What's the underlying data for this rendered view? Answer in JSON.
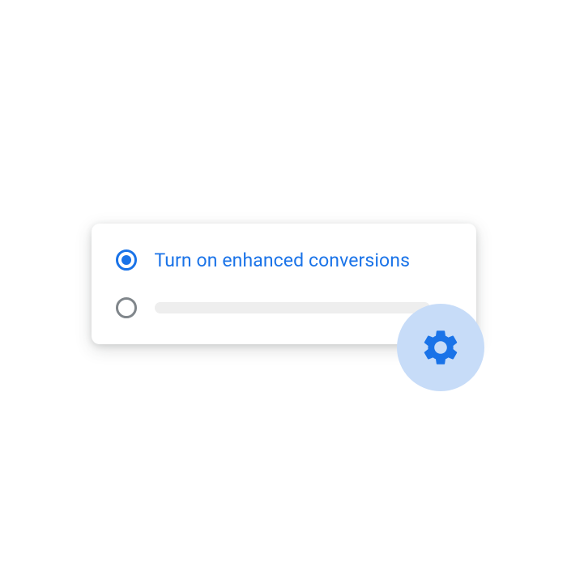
{
  "card": {
    "options": [
      {
        "label": "Turn on enhanced conversions",
        "selected": true
      },
      {
        "label": "",
        "selected": false
      }
    ]
  },
  "icons": {
    "gear": "gear-icon"
  },
  "colors": {
    "accent": "#1a73e8",
    "badge_bg": "#c7dcf8",
    "placeholder": "#eeeeee",
    "radio_unselected": "#80868b"
  }
}
